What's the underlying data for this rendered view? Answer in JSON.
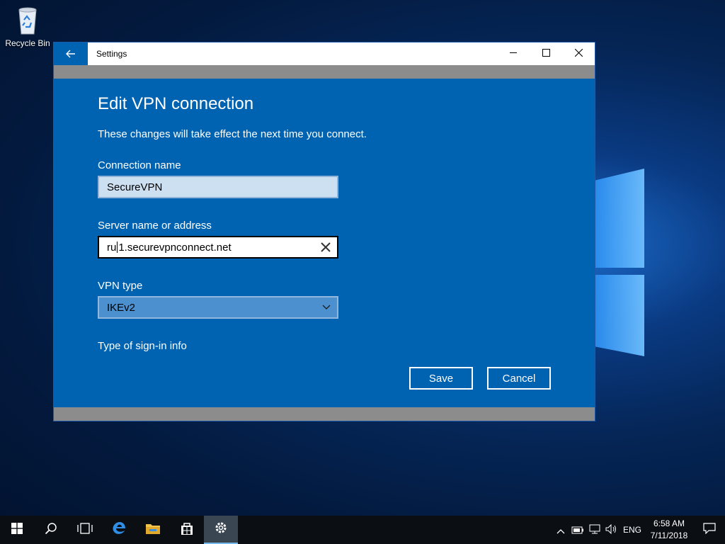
{
  "desktop": {
    "recycle_bin_label": "Recycle Bin"
  },
  "window": {
    "title": "Settings",
    "icons": {
      "back": "back-arrow-icon",
      "minimize": "minimize-icon",
      "maximize": "maximize-icon",
      "close": "close-icon"
    }
  },
  "dialog": {
    "title": "Edit VPN connection",
    "subtitle": "These changes will take effect the next time you connect.",
    "connection_name_label": "Connection name",
    "connection_name_value": "SecureVPN",
    "server_label": "Server name or address",
    "server_value_before_caret": "ru",
    "server_value_after_caret": "1.securevpnconnect.net",
    "vpn_type_label": "VPN type",
    "vpn_type_value": "IKEv2",
    "signin_label": "Type of sign-in info",
    "save_label": "Save",
    "cancel_label": "Cancel",
    "accent_color": "#0063b1"
  },
  "taskbar": {
    "language": "ENG",
    "time": "6:58 AM",
    "date": "7/11/2018",
    "items": [
      "start-icon",
      "search-icon",
      "task-view-icon",
      "edge-icon",
      "file-explorer-icon",
      "store-icon",
      "settings-icon"
    ]
  }
}
